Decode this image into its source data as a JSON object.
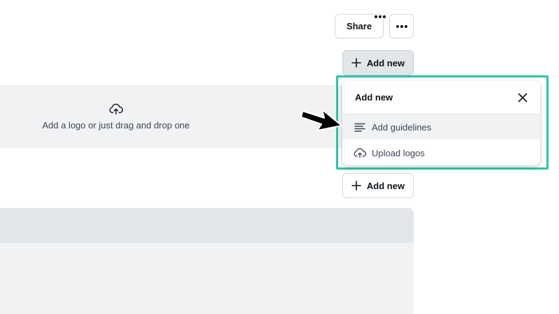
{
  "toolbar": {
    "share_label": "Share",
    "more_icon": "more-horizontal-icon"
  },
  "add_new_top": {
    "label": "Add new",
    "icon": "plus-icon"
  },
  "logo_dropzone": {
    "text": "Add a logo or just drag and drop one",
    "icon": "cloud-upload-icon"
  },
  "dropdown": {
    "title": "Add new",
    "close_icon": "close-icon",
    "items": [
      {
        "label": "Add guidelines",
        "icon": "text-lines-icon"
      },
      {
        "label": "Upload logos",
        "icon": "cloud-upload-icon"
      }
    ]
  },
  "add_new_bottom": {
    "label": "Add new",
    "icon": "plus-icon"
  },
  "card": {
    "more_icon": "more-horizontal-icon"
  },
  "annotation": {
    "highlight_color": "#2ec4a6",
    "arrow_color": "#000000"
  }
}
